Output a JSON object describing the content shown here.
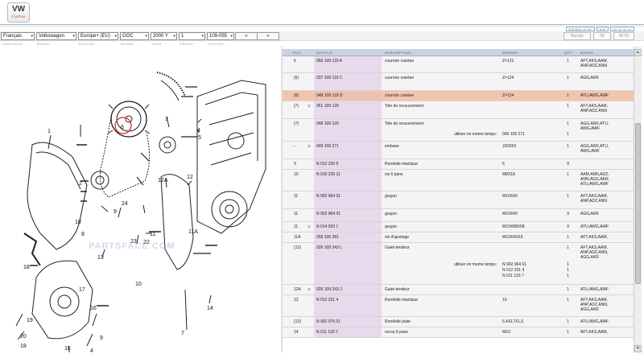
{
  "header": {
    "logo_text": "VW",
    "logo_sub": "Cartas",
    "buttons": [
      "DEMO-FIN",
      "EN",
      "M E N U"
    ]
  },
  "toolbar": {
    "language": "Français",
    "brand": "Volkswagen",
    "region": "Europe+ (EU)",
    "model": "GOC",
    "year": "2000",
    "year_suffix": "Y",
    "group": "1",
    "illustration": "109-055",
    "prev": "«",
    "next": "»",
    "search_placeholder": "Bereite",
    "right_a": "00",
    "right_b": "06:20"
  },
  "field_labels": [
    "LANGUAGE",
    "BRAND",
    "REGION",
    "MODEL",
    "YEAR",
    "GROUP",
    "HISTORY"
  ],
  "table": {
    "headers": {
      "pos": "POS",
      "article": "ARTICLE",
      "description": "DESCRIPTION",
      "remark": "REMARK",
      "qty": "QTY",
      "model": "MODEL"
    },
    "rows": [
      {
        "pos": "6",
        "flag": "",
        "article": "056 109 119 A",
        "description": "courroie crantee",
        "remark": "Z=121",
        "qty": "1",
        "model": [
          "AFT,AKS,AAM,",
          "ANP,ADZ,ANN"
        ],
        "h": 21
      },
      {
        "pos": "(6)",
        "flag": "",
        "article": "037 109 119 C",
        "description": "courroie crantee",
        "remark": "Z=124",
        "qty": "1",
        "model": [
          "AGG,AKR"
        ],
        "h": 22
      },
      {
        "pos": "(6)",
        "flag": "",
        "article": "048 109 119 D",
        "description": "courroie crantee",
        "remark": "Z=124",
        "qty": "1",
        "model": [
          "ATU,AWG,AWF"
        ],
        "h": 13,
        "selected": true
      },
      {
        "pos": "(7)",
        "flag": "c",
        "article": "051 109 129",
        "description": "Tole de recouvrement",
        "remark": "",
        "qty": "1",
        "model": [
          "AFT,AKS,AAM,",
          "ANP,ADZ,ANN"
        ],
        "h": 22
      },
      {
        "pos": "(7)",
        "flag": "",
        "article": "048 109 129",
        "description": "Tole de recouvrement",
        "remark": "",
        "qty": "1",
        "model": [
          "AGG,AKR,ATU,",
          "AWG,AWF"
        ],
        "h": 28,
        "extra": {
          "label": "utiliser en meme temps:",
          "value": "049 109 271",
          "qty": "1"
        }
      },
      {
        "pos": "-",
        "flag": "c",
        "article": "049 109 271",
        "description": "embase",
        "remark": "J20X53",
        "qty": "1",
        "model": [
          "AGG,AKR,ATU,",
          "AWG,AWF"
        ],
        "h": 22
      },
      {
        "pos": "9",
        "flag": "",
        "article": "N 012 226 5",
        "description": "Rondelle elastique",
        "remark": "6",
        "qty": "X",
        "model": [],
        "h": 13
      },
      {
        "pos": "10",
        "flag": "",
        "article": "N 010 239 11",
        "description": "vis 6 pans",
        "remark": "M8X18",
        "qty": "1",
        "model": [
          "AAM,ANN,ADZ,",
          "ANN,AGG,AKR,",
          "ATU,AWG,AWF"
        ],
        "h": 27
      },
      {
        "pos": "11",
        "flag": "",
        "article": "N 902 964 01",
        "description": "goujon",
        "remark": "M10X40",
        "qty": "1",
        "model": [
          "AFT,AKS,AAM,",
          "ANP,ADZ,ANN"
        ],
        "h": 22
      },
      {
        "pos": "11",
        "flag": "",
        "article": "N 902 964 01",
        "description": "goujon",
        "remark": "M10X40",
        "qty": "X",
        "model": [
          "AGG,AKR"
        ],
        "h": 16
      },
      {
        "pos": "11",
        "flag": "c",
        "article": "N 014 593 1",
        "description": "goujon",
        "remark": "M10X88X58",
        "qty": "X",
        "model": [
          "ATU,AWG,AWF"
        ],
        "h": 13
      },
      {
        "pos": "11A",
        "flag": "",
        "article": "058 109 281",
        "description": "vis d'ajustage",
        "remark": "M10X40/15",
        "qty": "1",
        "model": [
          "AFT,AKS,AAM,"
        ],
        "h": 13
      },
      {
        "pos": "(12)",
        "flag": "",
        "article": "026 109 243 L",
        "description": "Galet-tendeur",
        "remark": "",
        "qty": "1",
        "model": [
          "AFT,AKS,AAM,",
          "ANP,ADZ,ANN,",
          "AGG,AKR"
        ],
        "h": 52,
        "extra3": {
          "label": "utiliser en meme temps:",
          "lines": [
            "N   902 964 01",
            "N   012 231 4",
            "N   011 133 7"
          ],
          "qtys": [
            "1",
            "1",
            "1"
          ]
        }
      },
      {
        "pos": "12A",
        "flag": "c",
        "article": "026 109 243 J",
        "description": "Galet-tendeur",
        "remark": "",
        "qty": "1",
        "model": [
          "ATU,AWG,AWF"
        ],
        "h": 13
      },
      {
        "pos": "13",
        "flag": "",
        "article": "N 012 231 4",
        "description": "Rondelle elastique",
        "remark": "10",
        "qty": "1",
        "model": [
          "AFT,AKS,AAM,",
          "ANP,ADZ,ANN,",
          "AGG,AKR"
        ],
        "h": 27
      },
      {
        "pos": "(13)",
        "flag": "",
        "article": "N 902 076 01",
        "description": "Rondelle plate",
        "remark": "6,4X17X1,6",
        "qty": "1",
        "model": [
          "ATU,AWG,AWF"
        ],
        "h": 13
      },
      {
        "pos": "14",
        "flag": "",
        "article": "N 011 133 7",
        "description": "ecrou 6 pans",
        "remark": "M10",
        "qty": "1",
        "model": [
          "AFT,AKS,AAM,"
        ],
        "h": 13
      }
    ]
  },
  "diagram": {
    "watermark": "PARTSFACE.COM",
    "callouts": [
      "1",
      "2",
      "3",
      "4",
      "5",
      "6",
      "7",
      "8",
      "9",
      "10",
      "11",
      "11A",
      "12",
      "12A",
      "13",
      "14",
      "15",
      "16",
      "17",
      "18",
      "19",
      "20",
      "21",
      "22",
      "23",
      "24"
    ],
    "highlight": "6"
  },
  "colors": {
    "selected_row": "#f3c5ad",
    "article_column": "#e8d9ec",
    "header_bg": "#c7d3e0",
    "highlight_circle": "#d62020"
  }
}
